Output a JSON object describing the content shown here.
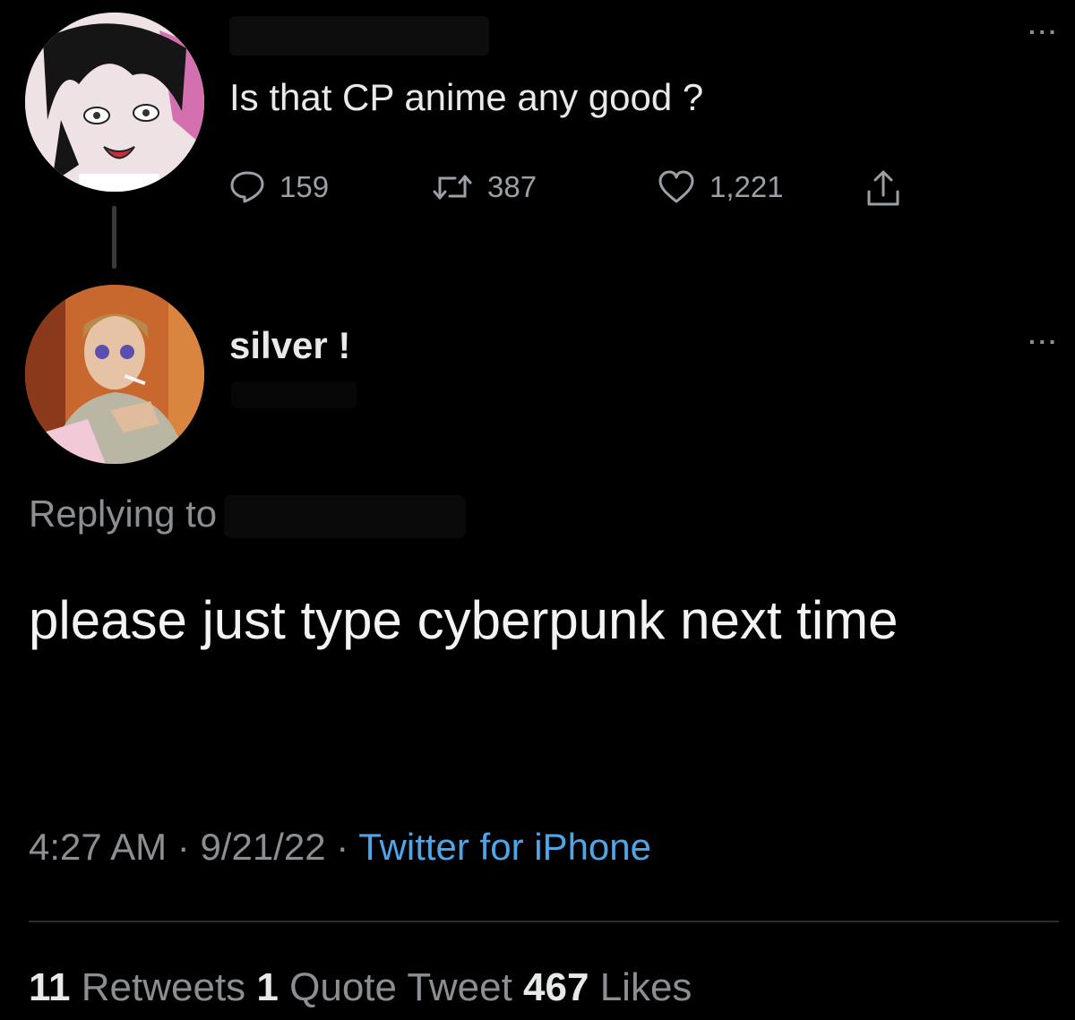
{
  "parent_tweet": {
    "text": "Is that CP anime any good ?",
    "reply_count": "159",
    "retweet_count": "387",
    "like_count": "1,221",
    "icons": [
      "reply-icon",
      "retweet-icon",
      "like-icon",
      "share-icon",
      "more-icon"
    ]
  },
  "reply_tweet": {
    "display_name": "silver !",
    "replying_to_label": "Replying to",
    "text": "please just type cyberpunk next time",
    "time": "4:27 AM",
    "date": "9/21/22",
    "separator": "·",
    "source": "Twitter for iPhone",
    "stats": {
      "retweets_count": "11",
      "retweets_label": "Retweets",
      "quotes_count": "1",
      "quotes_label": "Quote Tweet",
      "likes_count": "467",
      "likes_label": "Likes"
    }
  },
  "more_label": "···",
  "colors": {
    "background": "#000000",
    "text": "#e7e9ea",
    "muted": "#8b8f93",
    "link": "#4ea6e8"
  }
}
